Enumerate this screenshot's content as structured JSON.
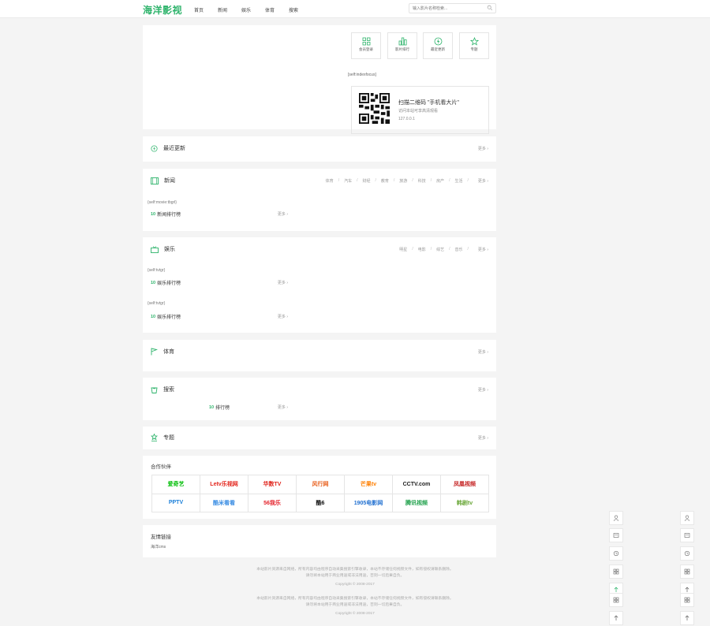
{
  "header": {
    "logo": "海洋影视",
    "nav": [
      "首页",
      "新闻",
      "娱乐",
      "体育",
      "搜索"
    ],
    "search_placeholder": "输入影片名称检索..."
  },
  "top": {
    "buttons": [
      {
        "label": "会员登录",
        "icon": "grid-icon"
      },
      {
        "label": "影片排行",
        "icon": "chart-icon"
      },
      {
        "label": "最近更新",
        "icon": "lightning-icon"
      },
      {
        "label": "专题",
        "icon": "star-icon"
      }
    ],
    "selfidx": "[self:indexfocus]",
    "qr_title": "扫描二维码 \"手机看大片\"",
    "qr_sub": "访问本站可享高清观看",
    "qr_ip": "127.0.0.1"
  },
  "sections": {
    "latest": {
      "title": "最近更新",
      "more": "更多"
    },
    "news": {
      "title": "新闻",
      "cats": [
        "体育",
        "汽车",
        "财经",
        "教育",
        "旅游",
        "科技",
        "房产",
        "生活"
      ],
      "more": "更多",
      "path": "{self:movie:tbgrl}",
      "rank_label": "新闻排行榜",
      "rank_more": "更多"
    },
    "ent": {
      "title": "娱乐",
      "cats": [
        "明星",
        "电影",
        "综艺",
        "音乐"
      ],
      "more": "更多",
      "path1": "{self:tvtgr}",
      "rank1_label": "娱乐排行榜",
      "rank1_more": "更多",
      "path2": "{self:tvtgr}",
      "rank2_label": "娱乐排行榜",
      "rank2_more": "更多"
    },
    "sports": {
      "title": "体育",
      "more": "更多"
    },
    "search": {
      "title": "搜索",
      "more": "更多",
      "rank_label": "排行榜",
      "rank_more": "更多"
    },
    "topics": {
      "title": "专题",
      "more": "更多"
    }
  },
  "partners": {
    "title": "合作伙伴",
    "logos": [
      {
        "text": "爱奇艺",
        "color": "#00be06"
      },
      {
        "text": "Letv乐视网",
        "color": "#e3241b"
      },
      {
        "text": "华数TV",
        "color": "#e0241b"
      },
      {
        "text": "风行网",
        "color": "#e85e1a"
      },
      {
        "text": "芒果tv",
        "color": "#ff7f00"
      },
      {
        "text": "CCTV.com",
        "color": "#222222"
      },
      {
        "text": "凤凰视频",
        "color": "#c41e1e"
      },
      {
        "text": "PPTV",
        "color": "#1b7fd9"
      },
      {
        "text": "酷米看看",
        "color": "#3b8ee3"
      },
      {
        "text": "56我乐",
        "color": "#e4222b"
      },
      {
        "text": "酷6",
        "color": "#111111"
      },
      {
        "text": "1905电影网",
        "color": "#1f6fd0"
      },
      {
        "text": "腾讯视频",
        "color": "#1ea04a"
      },
      {
        "text": "韩剧tv",
        "color": "#6aa738"
      }
    ]
  },
  "friends": {
    "title": "友情链接",
    "link": "海洋cms"
  },
  "footer": {
    "line1": "本站影片资源来自网络，所有内容均由程序自动采集搜索引擎收录，本站不存储任何视频文件，如有侵权请联系删除。",
    "line2": "请勿将本站用于商业用途或非法用途，否则一切后果自负。",
    "line3": "Copyright © 2008-2017",
    "line4": "本站影片资源来自网络，所有内容均由程序自动采集搜索引擎收录，本站不存储任何视频文件，如有侵权请联系删除。",
    "line5": "请勿将本站用于商业用途或非法用途，否则一切后果自负。",
    "line6": "Copyright © 2008-2017"
  },
  "colors": {
    "accent": "#2cb36a",
    "bg": "#f4f4f4"
  }
}
